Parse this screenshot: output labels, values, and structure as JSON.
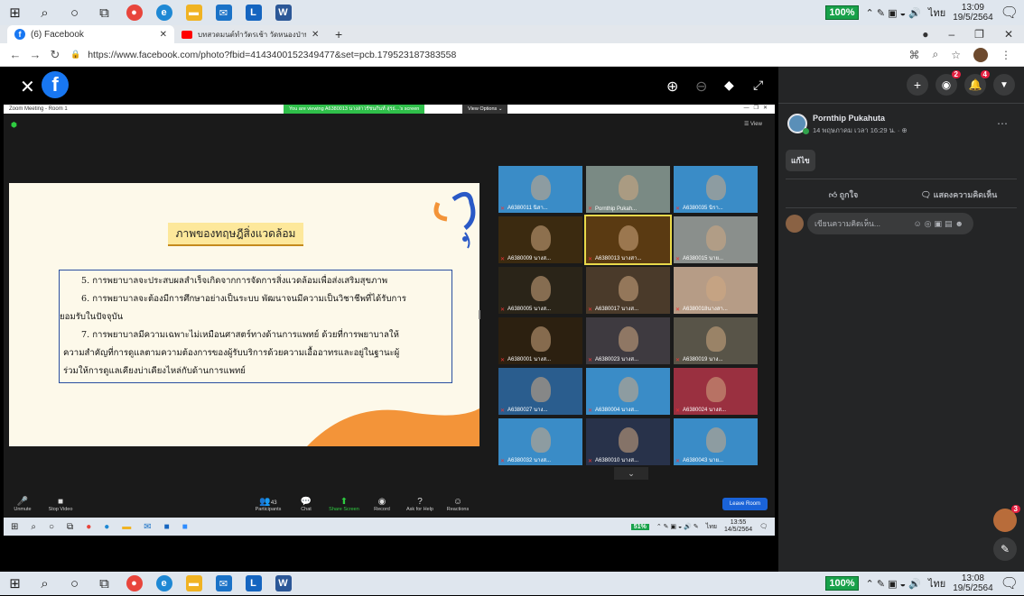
{
  "taskbar": {
    "battery": "100%",
    "lang": "ไทย",
    "time_top": "13:09",
    "date_top": "19/5/2564",
    "time_bottom": "13:08",
    "date_bottom": "19/5/2564"
  },
  "browser": {
    "tab1_title": "(6) Facebook",
    "tab2_title": "บทสวดมนต์ทำวัตรเช้า วัดหนองป่าพง",
    "url": "https://www.facebook.com/photo?fbid=4143400152349477&set=pcb.179523187383558"
  },
  "zoom": {
    "window_title": "Zoom Meeting - Room 1",
    "viewing_banner": "You are viewing A6380013 นางสาวรัชนกันท์ สุรธ...'s screen",
    "view_options": "View Options ⌄",
    "view_label": "☰ View",
    "participants_count": "43",
    "leave_label": "Leave Room",
    "controls": [
      "Unmute",
      "Stop Video",
      "Participants",
      "Chat",
      "Share Screen",
      "Record",
      "Ask for Help",
      "Reactions"
    ],
    "inner_battery": "51%",
    "inner_time": "13:55",
    "inner_date": "14/5/2564"
  },
  "slide": {
    "title": "ภาพของทฤษฎีสิ่งแวดล้อม",
    "line1": "5. การพยาบาลจะประสบผลสำเร็จเกิดจากการจัดการสิ่งแวดล้อมเพื่อส่งเสริมสุขภาพ",
    "line2": "6. การพยาบาลจะต้องมีการศึกษาอย่างเป็นระบบ พัฒนาจนมีความเป็นวิชาชีพที่ได้รับการ",
    "line3": "ยอมรับในปัจจุบัน",
    "line4": "7. การพยาบาลมีความเฉพาะไม่เหมือนศาสตร์ทางด้านการแพทย์ ด้วยที่การพยาบาลให้",
    "line5": "ความสำคัญที่การดูแลตามความต้องการของผู้รับบริการด้วยความเอื้ออาทรและอยู่ในฐานะผู้",
    "line6": "ร่วมให้การดูแลเคียงบ่าเคียงไหล่กับด้านการแพทย์"
  },
  "participants": [
    {
      "label": "A6380011 นิสา...",
      "color": "#3a8cc7"
    },
    {
      "label": "Pornthip Pukah...",
      "color": "#7a8a84"
    },
    {
      "label": "A6380035 นิรา...",
      "color": "#3a8cc7"
    },
    {
      "label": "A6380009 นางส...",
      "color": "#3b2a10"
    },
    {
      "label": "A6380013 นางสา...",
      "color": "#5a3a12"
    },
    {
      "label": "A6380015 นาย...",
      "color": "#8a8f8c"
    },
    {
      "label": "A6380005 นางส...",
      "color": "#2a2418"
    },
    {
      "label": "A6380017 นางส...",
      "color": "#4a3a2a"
    },
    {
      "label": "A6380018นางสา...",
      "color": "#b69c86"
    },
    {
      "label": "A6380001 นางส...",
      "color": "#2c2010"
    },
    {
      "label": "A6380023 นางส...",
      "color": "#3e3a40"
    },
    {
      "label": "A6380019 นาง...",
      "color": "#585448"
    },
    {
      "label": "A6380027 นาง...",
      "color": "#2a5d8e"
    },
    {
      "label": "A6380004 นางส...",
      "color": "#3a8cc7"
    },
    {
      "label": "A6380024 นางส...",
      "color": "#9a3040"
    },
    {
      "label": "A6380032 นางส...",
      "color": "#3a8cc7"
    },
    {
      "label": "A6380010 นางส...",
      "color": "#28324a"
    },
    {
      "label": "A6380043 นาย...",
      "color": "#3a8cc7"
    }
  ],
  "post": {
    "author": "Pornthip Pukahuta",
    "date": "14 พฤษภาคม เวลา 16:29 น. · ⊕",
    "edit": "แก้ไข",
    "like": "ถูกใจ",
    "comment": "แสดงความคิดเห็น",
    "comment_placeholder": "เขียนความคิดเห็น..."
  },
  "badges": {
    "messenger": "2",
    "notifications": "4",
    "chat": "3"
  }
}
